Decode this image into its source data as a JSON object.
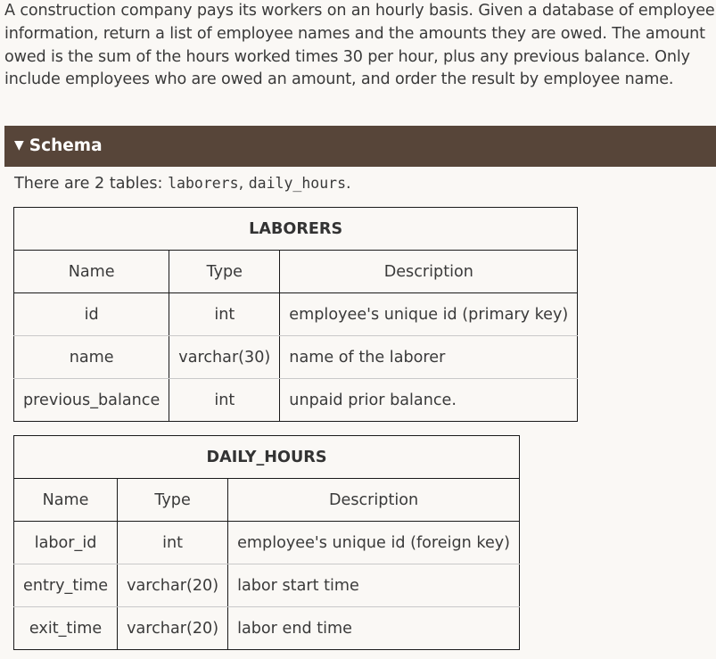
{
  "intro": {
    "lines": [
      "A construction company pays its workers on an hourly basis. Given a database of employee",
      "information, return a list of employee names and the amounts they are owed. The amount",
      "owed is the sum of the hours worked times 30 per hour, plus any previous balance. Only",
      "include employees who are owed an amount, and order the result by employee name."
    ]
  },
  "schema": {
    "toggle_icon": "triangle-down-icon",
    "title": "Schema",
    "colors": {
      "header_bg": "#574539",
      "header_text": "#ffffff",
      "page_bg": "#faf8f5"
    }
  },
  "tables_intro": {
    "prefix": "There are 2 tables: ",
    "table1": "laborers",
    "sep": ", ",
    "table2": "daily_hours",
    "suffix": "."
  },
  "laborers": {
    "title": "LABORERS",
    "columns": [
      "Name",
      "Type",
      "Description"
    ],
    "rows": [
      [
        "id",
        "int",
        "employee's unique id (primary key)"
      ],
      [
        "name",
        "varchar(30)",
        "name of the laborer"
      ],
      [
        "previous_balance",
        "int",
        "unpaid prior balance."
      ]
    ]
  },
  "daily_hours": {
    "title": "DAILY_HOURS",
    "columns": [
      "Name",
      "Type",
      "Description"
    ],
    "rows": [
      [
        "labor_id",
        "int",
        "employee's unique id (foreign key)"
      ],
      [
        "entry_time",
        "varchar(20)",
        "labor start time"
      ],
      [
        "exit_time",
        "varchar(20)",
        "labor end time"
      ]
    ]
  }
}
